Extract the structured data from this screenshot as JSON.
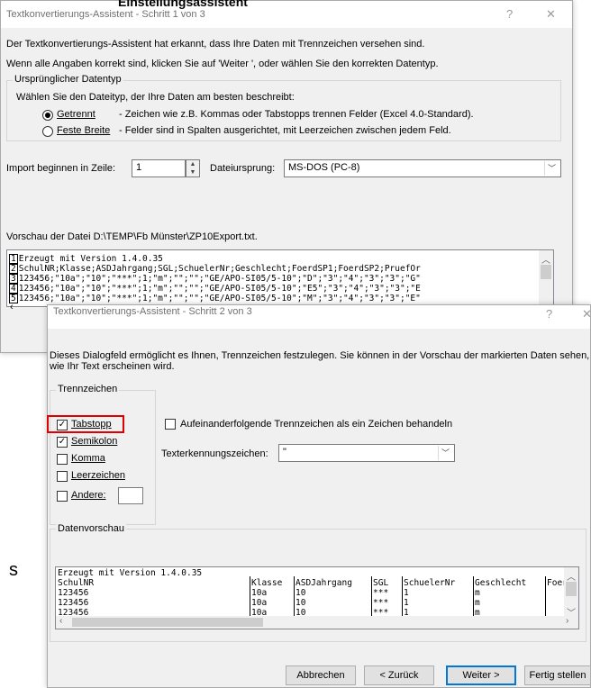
{
  "bg_partial_text": "s",
  "step1": {
    "title": "Textkonvertierungs-Assistent - Schritt 1 von 3",
    "help": "?",
    "close": "✕",
    "cropped_heading": "Einstellungsassistent",
    "intro_line1": "Der Textkonvertierungs-Assistent hat erkannt, dass Ihre Daten mit Trennzeichen versehen sind.",
    "intro_line2": "Wenn alle Angaben korrekt sind, klicken Sie auf 'Weiter ', oder wählen Sie den korrekten Datentyp.",
    "group_label": "Ursprünglicher Datentyp",
    "group_prompt": "Wählen Sie den Dateityp, der Ihre Daten am besten beschreibt:",
    "opt1_label": "Getrennt",
    "opt1_desc": "- Zeichen wie z.B. Kommas oder Tabstopps trennen Felder (Excel 4.0-Standard).",
    "opt2_label": "Feste Breite",
    "opt2_desc": "- Felder sind in Spalten ausgerichtet, mit Leerzeichen zwischen jedem Feld.",
    "import_label": "Import beginnen in Zeile:",
    "import_value": "1",
    "origin_label": "Dateiursprung:",
    "origin_value": "MS-DOS (PC-8)",
    "preview_label": "Vorschau der Datei D:\\TEMP\\Fb Münster\\ZP10Export.txt.",
    "preview_lines": [
      {
        "n": "1",
        "t": "Erzeugt mit Version 1.4.0.35"
      },
      {
        "n": "2",
        "t": "SchulNR;Klasse;ASDJahrgang;SGL;SchuelerNr;Geschlecht;FoerdSP1;FoerdSP2;PruefOr"
      },
      {
        "n": "3",
        "t": "123456;\"10a\";\"10\";\"***\";1;\"m\";\"\";\"\";\"GE/APO-SI05/5-10\";\"D\";\"3\";\"4\";\"3\";\"3\";\"G\""
      },
      {
        "n": "4",
        "t": "123456;\"10a\";\"10\";\"***\";1;\"m\";\"\";\"\";\"GE/APO-SI05/5-10\";\"E5\";\"3\";\"4\";\"3\";\"3\";\"E"
      },
      {
        "n": "5",
        "t": "123456;\"10a\";\"10\";\"***\";1;\"m\";\"\";\"\";\"GE/APO-SI05/5-10\";\"M\";\"3\";\"4\";\"3\";\"3\";\"E\""
      }
    ]
  },
  "step2": {
    "title": "Textkonvertierungs-Assistent - Schritt 2 von 3",
    "help": "?",
    "close": "✕",
    "intro": "Dieses Dialogfeld ermöglicht es Ihnen, Trennzeichen festzulegen. Sie können in der Vorschau der markierten Daten sehen,",
    "intro2": "wie Ihr Text erscheinen wird.",
    "delim_group": "Trennzeichen",
    "delims": [
      {
        "label": "Tabstopp",
        "checked": true
      },
      {
        "label": "Semikolon",
        "checked": true
      },
      {
        "label": "Komma",
        "checked": false
      },
      {
        "label": "Leerzeichen",
        "checked": false
      },
      {
        "label": "Andere:",
        "checked": false
      }
    ],
    "consecutive_label": "Aufeinanderfolgende Trennzeichen als ein Zeichen behandeln",
    "qualifier_label": "Texterkennungszeichen:",
    "qualifier_value": "\"",
    "data_preview_group": "Datenvorschau",
    "preview_first": "Erzeugt mit Version 1.4.0.35",
    "columns": [
      "SchulNR",
      "Klasse",
      "ASDJahrgang",
      "SGL",
      "SchuelerNr",
      "Geschlecht",
      "Foerd"
    ],
    "rows": [
      [
        "123456",
        "10a",
        "10",
        "***",
        "1",
        "m",
        ""
      ],
      [
        "123456",
        "10a",
        "10",
        "***",
        "1",
        "m",
        ""
      ],
      [
        "123456",
        "10a",
        "10",
        "***",
        "1",
        "m",
        ""
      ]
    ],
    "buttons": {
      "cancel": "Abbrechen",
      "back": "< Zurück",
      "next": "Weiter >",
      "finish": "Fertig stellen"
    }
  },
  "highlight_color": "#e00000",
  "accent_color": "#0078d7"
}
